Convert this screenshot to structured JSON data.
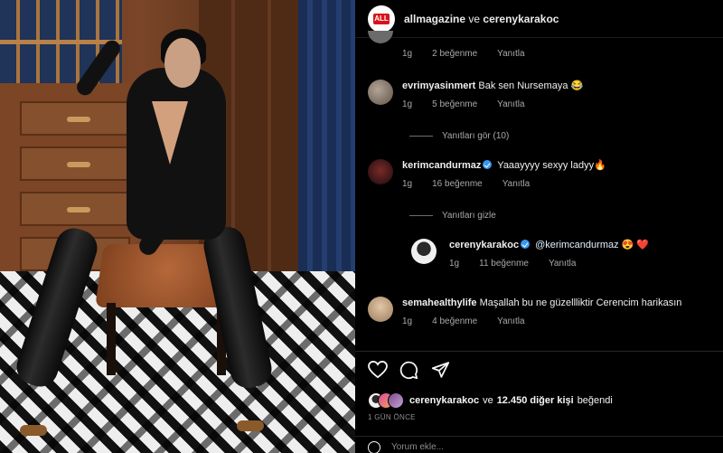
{
  "post": {
    "header": {
      "avatar_label": "ALL",
      "author": "allmagazine",
      "conjunction": "ve",
      "collaborator": "cerenykarakoc"
    },
    "comments": [
      {
        "username": "",
        "text": "",
        "time": "1g",
        "likes": "2 beğenme",
        "reply": "Yanıtla",
        "avatar_color": "#6b6b6b"
      },
      {
        "username": "evrimyasinmert",
        "text": "Bak sen Nursemaya 😂",
        "time": "1g",
        "likes": "5 beğenme",
        "reply": "Yanıtla",
        "avatar_color": "#8a7a6e"
      },
      {
        "username": "kerimcandurmaz",
        "text": "Yaaayyyy sexyy ladyy🔥",
        "time": "1g",
        "likes": "16 beğenme",
        "reply": "Yanıtla",
        "verified": true,
        "avatar_color": "#5a1f1f"
      },
      {
        "username": "cerenykarakoc",
        "mention": "@kerimcandurmaz",
        "text": "😍 ❤️",
        "time": "1g",
        "likes": "11 beğenme",
        "reply": "Yanıtla",
        "verified": true,
        "avatar_color": "#d9d9d9"
      },
      {
        "username": "semahealthylife",
        "text": "Maşallah bu ne güzellliktir Cerencim harikasın",
        "time": "1g",
        "likes": "4 beğenme",
        "reply": "Yanıtla",
        "avatar_color": "#c9a98a"
      }
    ],
    "thread_toggles": {
      "show_replies": "Yanıtları gör (10)",
      "hide_replies": "Yanıtları gizle"
    },
    "actions": {
      "like_icon": "heart-icon",
      "comment_icon": "comment-icon",
      "share_icon": "share-icon"
    },
    "likes_line": {
      "user": "cerenykarakoc",
      "and": "ve",
      "others": "12.450 diğer kişi",
      "suffix": "beğendi"
    },
    "time_ago": "1 GÜN ÖNCE",
    "add_comment_placeholder": "Yorum ekle...",
    "colors": {
      "background": "#000000",
      "text": "#f5f5f5",
      "meta": "#a8a8a8",
      "verified": "#3897f0",
      "logo_red": "#d7141a"
    }
  }
}
